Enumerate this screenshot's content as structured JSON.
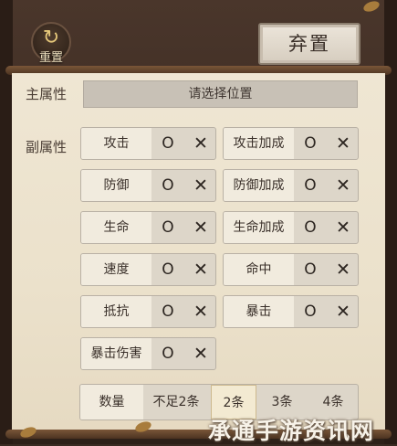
{
  "header": {
    "reset_label": "重置",
    "discard_label": "弃置"
  },
  "main_attribute": {
    "label": "主属性",
    "placeholder": "请选择位置"
  },
  "sub_attribute": {
    "label": "副属性",
    "option_on": "O",
    "option_off": "✕",
    "items": [
      {
        "name": "攻击"
      },
      {
        "name": "攻击加成"
      },
      {
        "name": "防御"
      },
      {
        "name": "防御加成"
      },
      {
        "name": "生命"
      },
      {
        "name": "生命加成"
      },
      {
        "name": "速度"
      },
      {
        "name": "命中"
      },
      {
        "name": "抵抗"
      },
      {
        "name": "暴击"
      },
      {
        "name": "暴击伤害"
      }
    ]
  },
  "count": {
    "label": "数量",
    "options": [
      "不足2条",
      "2条",
      "3条",
      "4条"
    ],
    "selected": "2条"
  },
  "watermark": "承通手游资讯网"
}
